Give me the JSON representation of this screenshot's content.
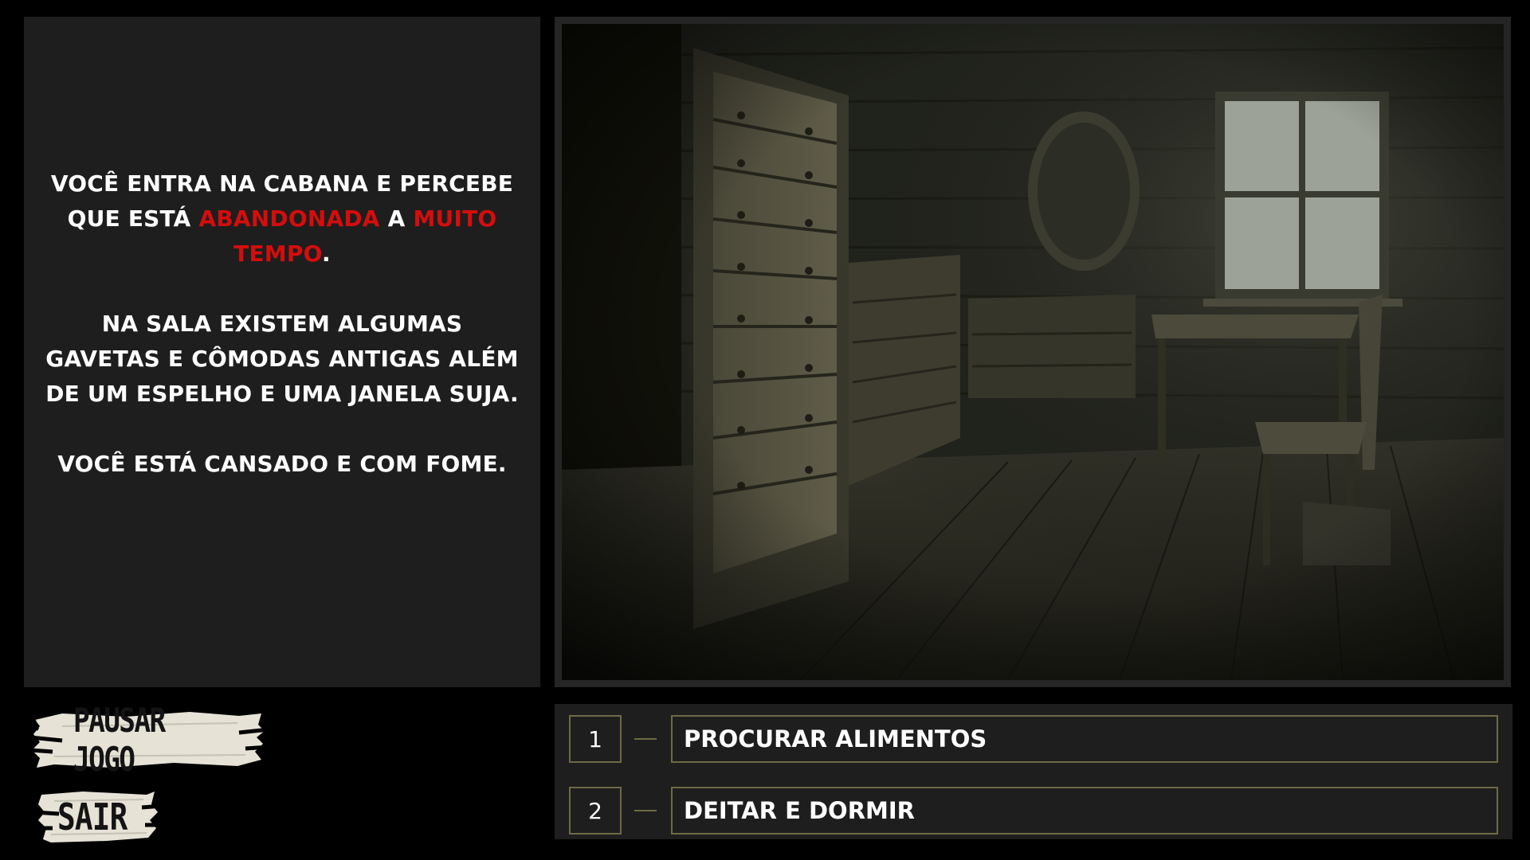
{
  "story": {
    "paragraph1": {
      "part1": "VOCÊ ENTRA NA CABANA E PERCEBE QUE ESTÁ ",
      "highlight1": "ABANDONADA",
      "part2": " A ",
      "highlight2": "MUITO TEMPO",
      "part3": "."
    },
    "paragraph2": "NA SALA EXISTEM ALGUMAS GAVETAS E CÔMODAS ANTIGAS ALÉM DE UM ESPELHO E UMA JANELA SUJA.",
    "paragraph3": "VOCÊ ESTÁ CANSADO E COM FOME.",
    "highlight_color": "#d40d0d"
  },
  "scene": {
    "description_icon": "abandoned-cabin-room-illustration"
  },
  "choices": [
    {
      "number": "1",
      "label": "PROCURAR ALIMENTOS"
    },
    {
      "number": "2",
      "label": "DEITAR E DORMIR"
    }
  ],
  "buttons": {
    "pause_label": "PAUSAR JOGO",
    "exit_label": "SAIR"
  },
  "colors": {
    "background": "#000000",
    "panel": "#1e1e1e",
    "choice_border": "#6e6a45",
    "button_plank": "#e6e2d6"
  }
}
